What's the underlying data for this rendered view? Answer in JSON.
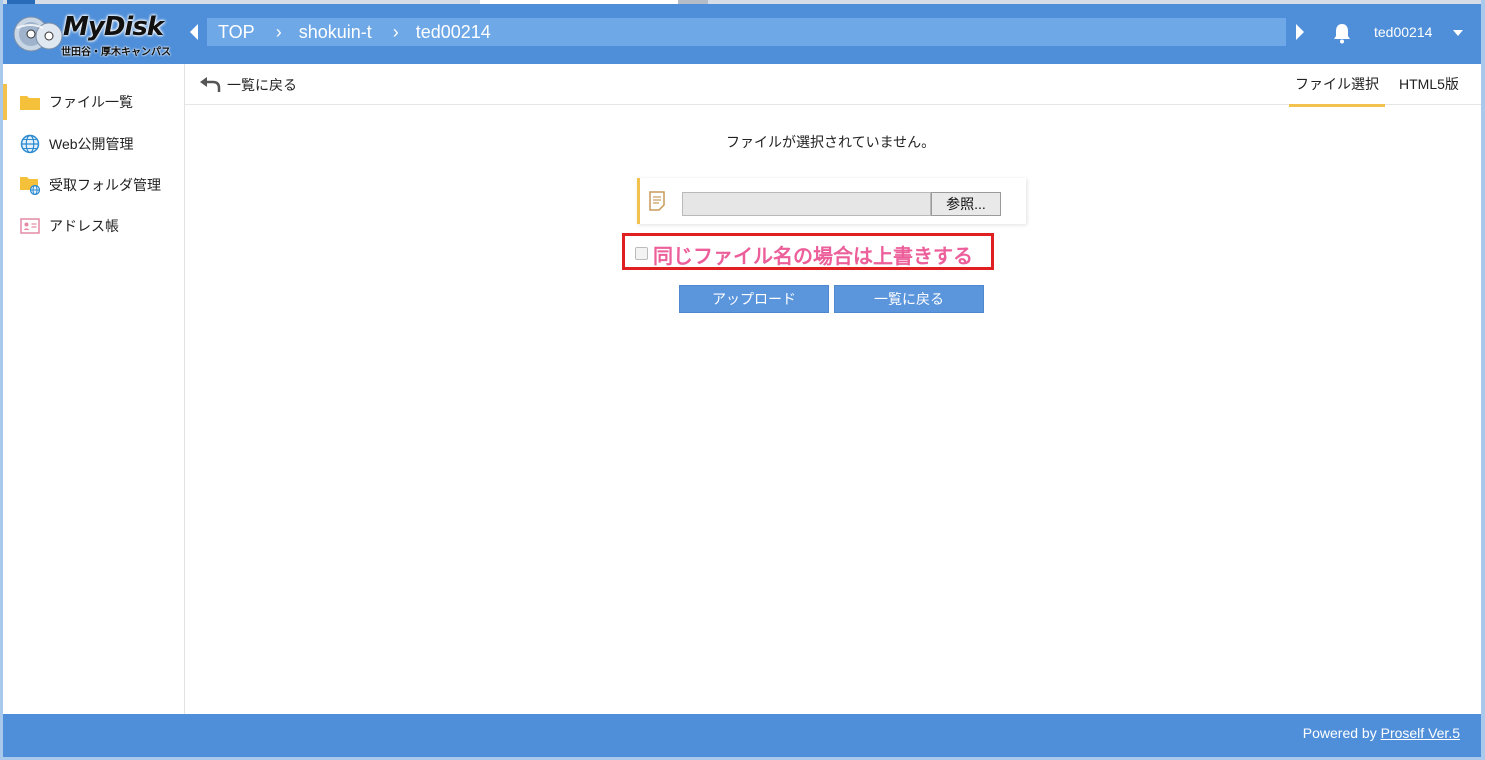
{
  "app": {
    "logo_name": "MyDisk",
    "logo_sub": "世田谷・厚木キャンパス"
  },
  "breadcrumb": {
    "items": [
      "TOP",
      "shokuin-t",
      "ted00214"
    ],
    "separator": "›"
  },
  "user": {
    "name": "ted00214"
  },
  "sidebar": {
    "items": [
      {
        "label": "ファイル一覧",
        "icon": "folder-icon",
        "active": true
      },
      {
        "label": "Web公開管理",
        "icon": "globe-icon",
        "active": false
      },
      {
        "label": "受取フォルダ管理",
        "icon": "folder-globe-icon",
        "active": false
      },
      {
        "label": "アドレス帳",
        "icon": "address-card-icon",
        "active": false
      }
    ]
  },
  "toolbar": {
    "back_label": "一覧に戻る",
    "tabs": [
      {
        "label": "ファイル選択",
        "active": true
      },
      {
        "label": "HTML5版",
        "active": false
      }
    ]
  },
  "upload": {
    "status": "ファイルが選択されていません。",
    "browse_label": "参照...",
    "overwrite_label": "同じファイル名の場合は上書きする",
    "overwrite_checked": false,
    "upload_button": "アップロード",
    "back_button": "一覧に戻る"
  },
  "footer": {
    "powered_prefix": "Powered by",
    "powered_link": "Proself Ver.5"
  },
  "colors": {
    "header": "#4f8fd9",
    "breadcrumb_bar": "#6ea8e6",
    "accent": "#f2c14e",
    "button": "#5b95dc",
    "highlight_border": "#e02020",
    "overwrite_text": "#ec5f9a"
  }
}
